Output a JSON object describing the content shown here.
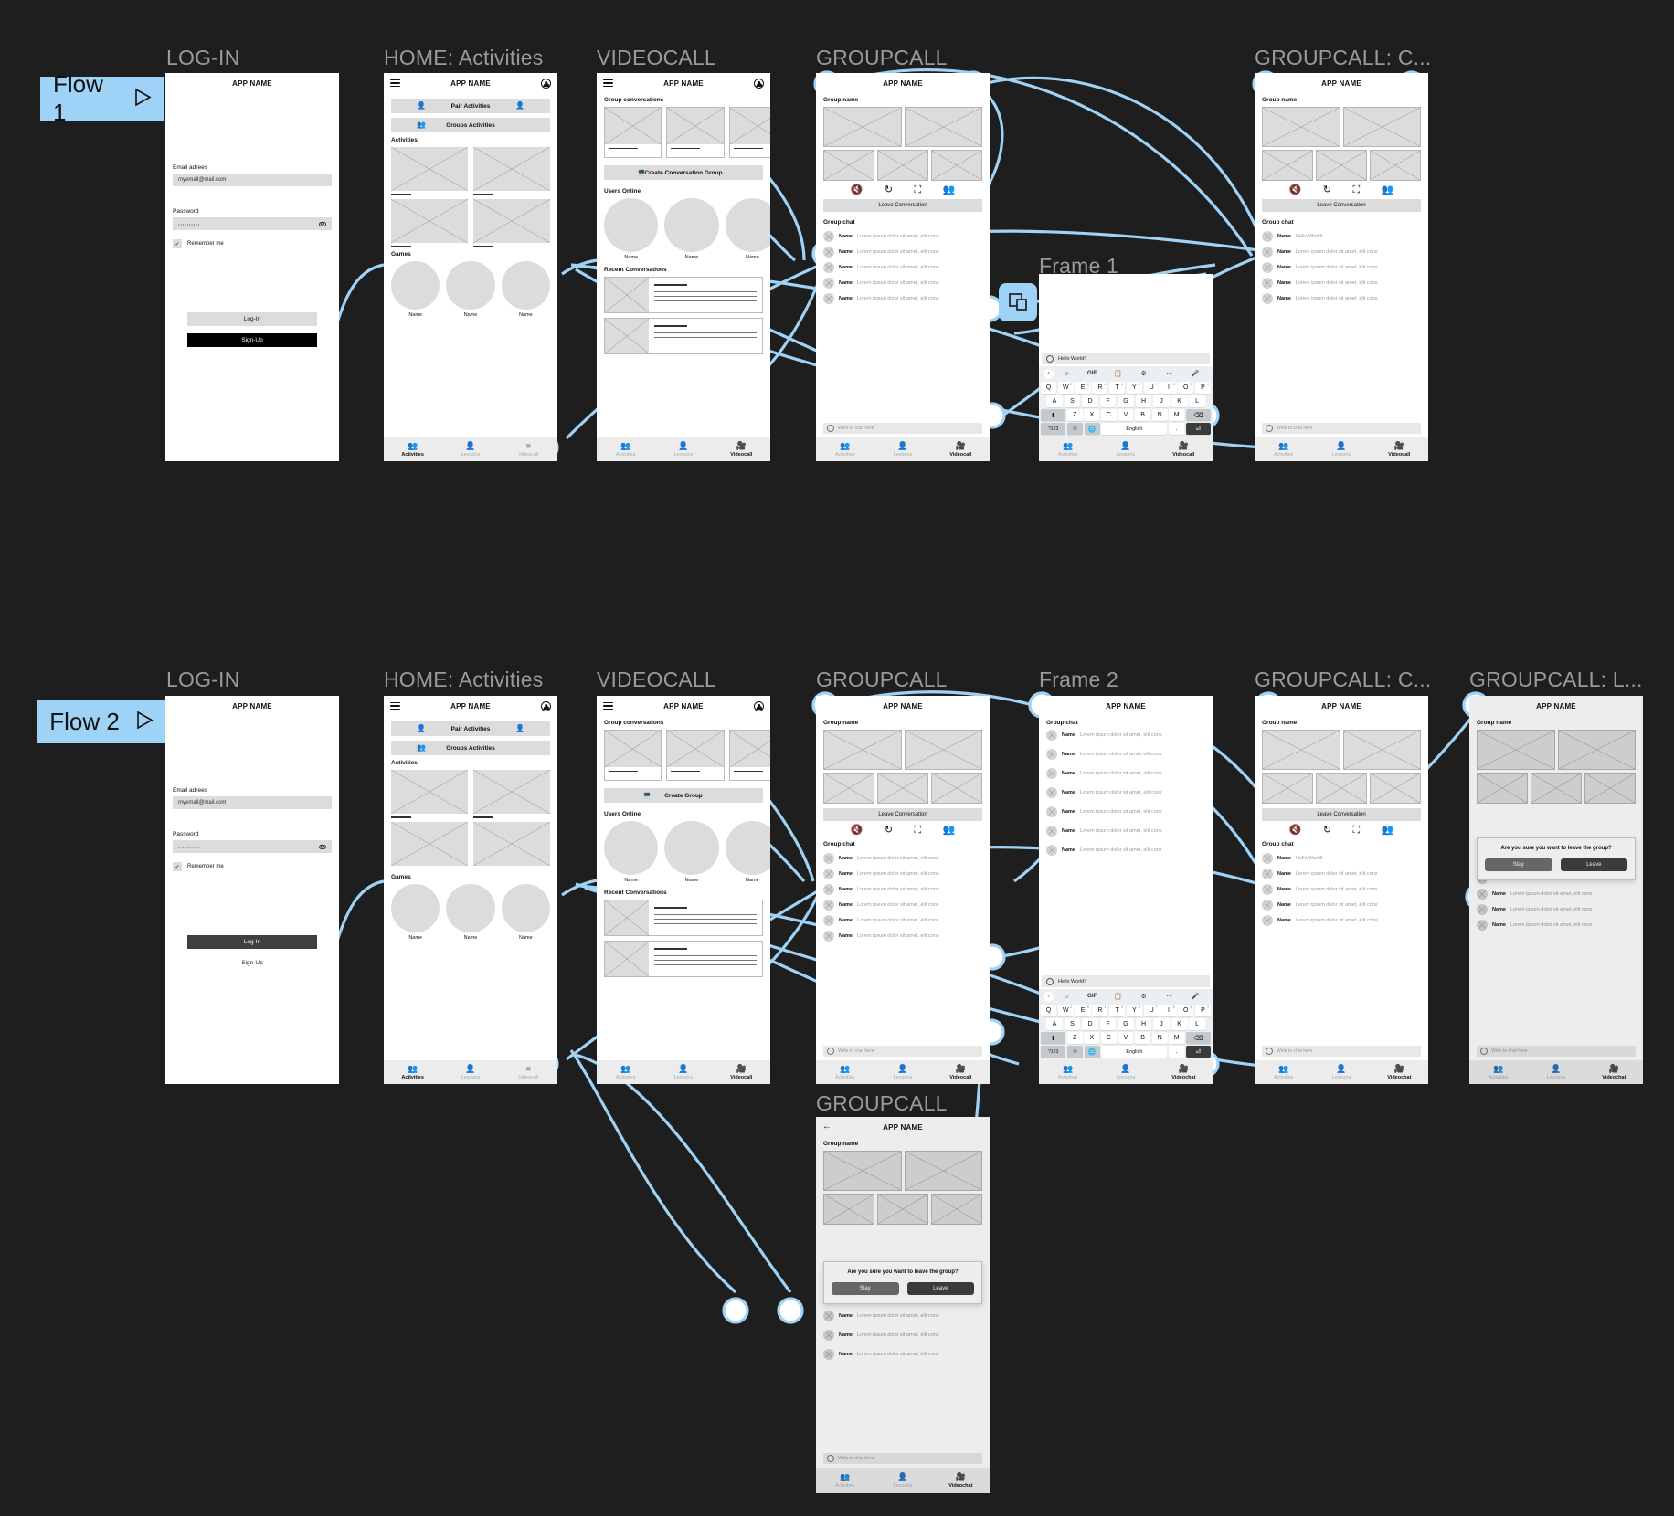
{
  "flows": [
    {
      "badge": "Flow 1",
      "arrow_icon": "play-triangle-icon"
    },
    {
      "badge": "Flow 2",
      "arrow_icon": "play-triangle-icon"
    }
  ],
  "frame_titles_flow1": [
    "LOG-IN",
    "HOME: Activities",
    "VIDEOCALL",
    "GROUPCALL",
    "Frame 1",
    "GROUPCALL: C..."
  ],
  "frame_titles_flow2": [
    "LOG-IN",
    "HOME: Activities",
    "VIDEOCALL",
    "GROUPCALL",
    "Frame 2",
    "GROUPCALL: C...",
    "GROUPCALL: L...",
    "GROUPCALL"
  ],
  "app": {
    "name": "APP NAME"
  },
  "login": {
    "email_label": "Email adrees",
    "email_value": "myemail@mail.com",
    "password_label": "Password",
    "password_value": "••••••••••",
    "remember_label": "Remember me",
    "login_button": "Log-In",
    "signup_button": "Sign-Up",
    "eye_icon": "eye-icon",
    "check_icon": "checkmark-icon"
  },
  "home": {
    "pair_activities": "Pair Activities",
    "groups_activities": "Groups Activities",
    "activities_title": "Activities",
    "games_title": "Games",
    "game_labels": [
      "Name",
      "Name",
      "Name"
    ],
    "pair_icon": "person-icon",
    "groups_icon": "group-people-icon"
  },
  "videocall": {
    "group_conversations_title": "Group conversations",
    "create_button_flow1": "Create  Conversation Group",
    "create_button_flow2": "Create  Group",
    "create_icon": "laptop-icon",
    "users_online_title": "Users Online",
    "user_labels": [
      "Name",
      "Name",
      "Name"
    ],
    "recent_title": "Recent Conversations"
  },
  "groupcall": {
    "group_name_title": "Group name",
    "leave_button": "Leave Conversation",
    "group_chat_title": "Group chat",
    "controls": [
      "mic-off-icon",
      "rotate-camera-icon",
      "video-off-icon",
      "add-person-icon"
    ],
    "chat_input_placeholder": "Write to chat here",
    "chat_name": "Name",
    "chat_message": "Lorem ipsum dolor sit amet, elit cons",
    "hello_message": "Hello World!",
    "chat_rows": 6
  },
  "leave_dialog": {
    "question": "Are you sure you want to leave the group?",
    "stay_button": "Stay",
    "leave_button": "Leave"
  },
  "keyboard": {
    "message": "Hello World!",
    "toolbar": [
      "back-chevron-icon",
      "sticker-icon",
      "GIF",
      "clipboard-icon",
      "gear-icon",
      "more-dots-icon",
      "microphone-icon"
    ],
    "row1": [
      "Q",
      "W",
      "E",
      "R",
      "T",
      "Y",
      "U",
      "I",
      "O",
      "P"
    ],
    "row1_nums": [
      "1",
      "2",
      "3",
      "4",
      "5",
      "6",
      "7",
      "8",
      "9",
      "0"
    ],
    "row2": [
      "A",
      "S",
      "D",
      "F",
      "G",
      "H",
      "J",
      "K",
      "L"
    ],
    "row3": [
      "Z",
      "X",
      "C",
      "V",
      "B",
      "N",
      "M"
    ],
    "shift_icon": "shift-icon",
    "backspace_icon": "backspace-icon",
    "symbols_key": "?123",
    "emoji_key": "emoji-icon",
    "globe_key": "globe-icon",
    "space_key": "English",
    "period_key": ".",
    "enter_key": "enter-icon"
  },
  "bottom_nav": {
    "items": [
      {
        "label": "Activities",
        "icon": "people-group-icon"
      },
      {
        "label": "Lessons",
        "icon": "book-icon"
      },
      {
        "label": "Videocall",
        "icon": "video-camera-icon"
      }
    ],
    "videochat_label": "Videochat"
  },
  "colors": {
    "canvas_bg": "#1e1e1e",
    "accent": "#9fd2f7",
    "frame_title": "#9a9a9a",
    "placeholder_grey": "#dcdcdc"
  }
}
